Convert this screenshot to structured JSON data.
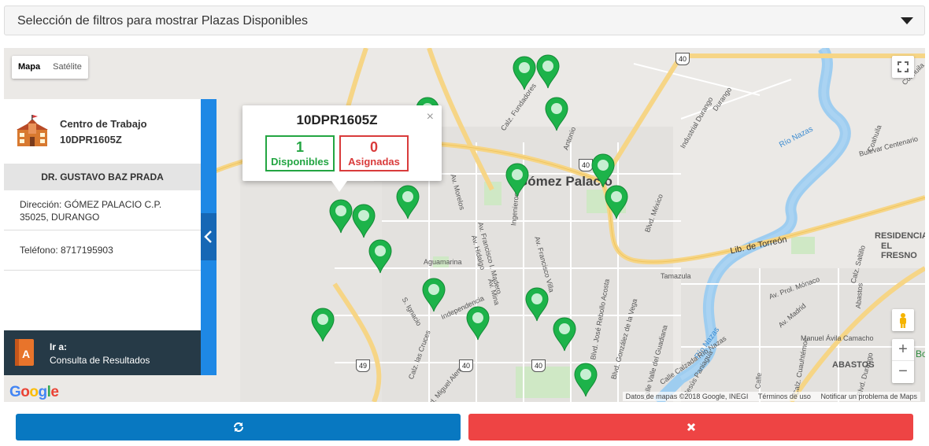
{
  "filter": {
    "title": "Selección de filtros para mostrar Plazas Disponibles"
  },
  "map_controls": {
    "map_label": "Mapa",
    "satellite_label": "Satélite"
  },
  "map_labels": {
    "city": "Gómez Palacio",
    "lib_torreon": "Lib. de Torreón",
    "rio_nazas_1": "Río Nazas",
    "rio_nazas_2": "Río Nazas",
    "residencial": "RESIDENCIAL",
    "el_fresno": "EL FRESNO",
    "abastos": "ABASTOS",
    "aguamarina": "Aguamarina",
    "tamazula": "Tamazula",
    "independencia": "Independencia",
    "calz_fundadores": "Calz. Fundadores",
    "av_morelos": "Av. Morelos",
    "av_hidalgo": "Av. Hidalgo",
    "av_fco_madero": "Av. Francisco I. Madero",
    "av_mina": "Av. Mina",
    "av_fco_villa": "Av. Francisco Villa",
    "industrial_durango": "Industrial Durango",
    "blvd_mexico": "Blvd. México",
    "coahuila": "Coahuila",
    "blvd_centenario": "Bulevar Centenario",
    "manuel_avila_camacho": "Manuel Ávila Camacho",
    "av_prol_monaco": "Av. Prol. Mónaco",
    "av_madrid": "Av. Madrid",
    "calz_las_cruces": "Calz. las Cruces",
    "blvd_miguel_aleman": "Blvd. Miguel Alemán",
    "s_ignacio": "S. Ignacio",
    "calle_valle_guadiana": "Calle Valle del Guadiana",
    "blvd_jose_rebollo": "Blvd. José Rebollo Acosta",
    "blvd_gonzalez_vega": "Blvd. González de la Vega",
    "calle_calzada_rio_nazas": "Calle Calzada Río Nazas",
    "jesus_paniagua": "Jesús Paniagua",
    "calz_cuauhtemoc": "Calz. Cuauhtémoc",
    "abastos_st": "Abastos",
    "calz_saltillo": "Calz. Saltillo",
    "blvd_durango": "Blvd. Durango",
    "ingenieros": "Ingenieros",
    "antonio": "Antonio",
    "durango": "Durango",
    "coahuila_top": "Coahuila",
    "bo": "Bo",
    "calle": "Calle",
    "hwy_40_a": "40",
    "hwy_40_b": "40",
    "hwy_40_c": "40",
    "hwy_40_d": "40",
    "hwy_49": "49"
  },
  "side_panel": {
    "work_center_label": "Centro de Trabajo",
    "work_center_code": "10DPR1605Z",
    "school_name": "DR. GUSTAVO BAZ PRADA",
    "address": "Dirección: GÓMEZ PALACIO C.P. 35025, DURANGO",
    "phone": "Teléfono: 8717195903",
    "goto_label": "Ir a:",
    "goto_target": "Consulta de Resultados"
  },
  "popup": {
    "code": "10DPR1605Z",
    "close": "×",
    "available_count": "1",
    "available_label": "Disponibles",
    "assigned_count": "0",
    "assigned_label": "Asignadas"
  },
  "attribution": {
    "data": "Datos de mapas ©2018 Google, INEGI",
    "terms": "Términos de uso",
    "report": "Notificar un problema de Maps"
  },
  "zoom": {
    "in": "+",
    "out": "−"
  },
  "markers_count": 17,
  "colors": {
    "marker": "#1db34a",
    "available": "#23a542",
    "assigned": "#d93b3b",
    "refresh_button": "#0878c1",
    "close_button": "#ee4444",
    "panel_strip": "#1e88e5",
    "goto_bg": "#263a47"
  },
  "icons": {
    "refresh": "refresh-icon",
    "close": "close-icon",
    "marker": "map-marker-icon",
    "school": "school-icon",
    "book": "book-icon"
  }
}
